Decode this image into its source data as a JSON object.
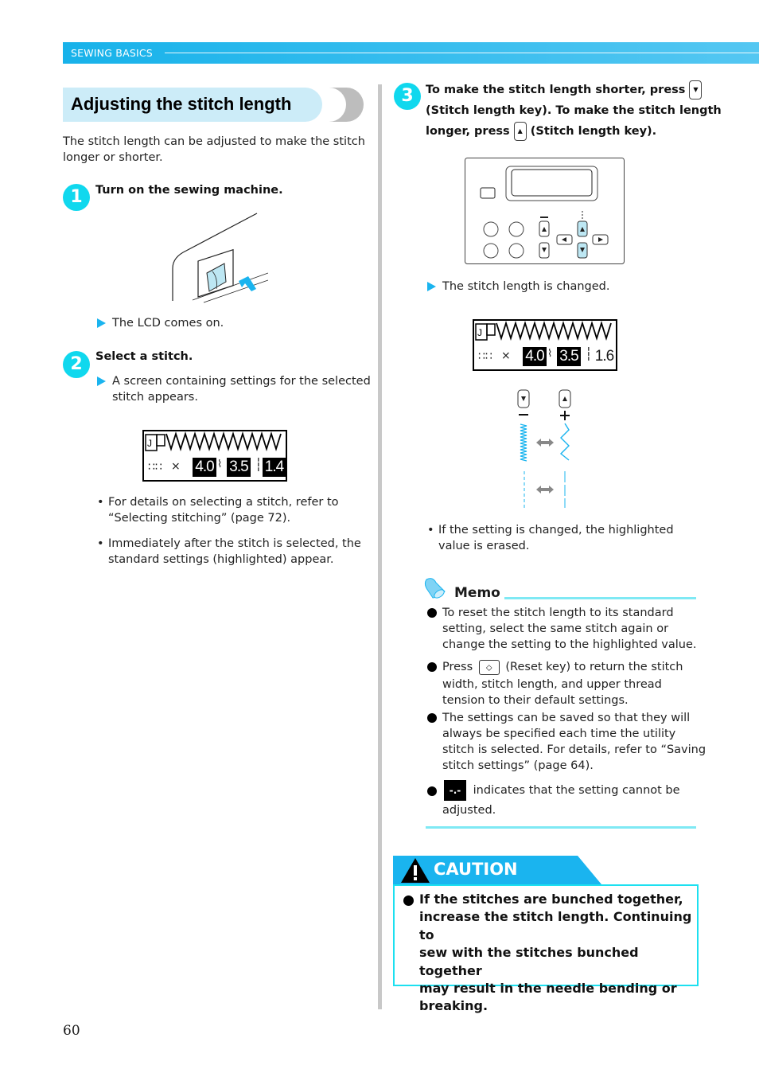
{
  "header": {
    "section": "SEWING BASICS",
    "color": "#17b2ea"
  },
  "title": "Adjusting the stitch length",
  "intro": [
    "The stitch length can be adjusted to make the stitch",
    "longer or shorter."
  ],
  "steps": [
    {
      "number": "1",
      "title": "Turn on the sewing machine.",
      "illustration": "power-switch",
      "result": "The LCD comes on."
    },
    {
      "number": "2",
      "title": "Select a stitch.",
      "result": [
        "A screen containing settings for the selected",
        "stitch appears."
      ],
      "lcd": {
        "width": "4.0",
        "length": "3.5",
        "tension": "1.4",
        "width_highlighted": true,
        "length_highlighted": true,
        "tension_highlighted": true
      },
      "notes": [
        [
          "For details on selecting a stitch, refer to",
          "“Selecting stitching” (page 72)."
        ],
        [
          "Immediately after the stitch is selected, the",
          "standard settings (highlighted) appear."
        ]
      ]
    },
    {
      "number": "3",
      "title_lines": [
        {
          "pre": "To make the stitch length shorter, press",
          "key": "down-arrow-key"
        },
        {
          "pre": "(Stitch length key). To make the stitch length"
        },
        {
          "pre": "longer, press",
          "key": "up-arrow-key",
          "post": "(Stitch length key)."
        }
      ],
      "result": "The stitch length is changed.",
      "lcd": {
        "width": "4.0",
        "length": "3.5",
        "tension": "1.6",
        "width_highlighted": true,
        "length_highlighted": true,
        "tension_highlighted": false
      },
      "diagram": {
        "minus": "−",
        "plus": "+"
      },
      "notes": [
        [
          "If the setting is changed, the highlighted",
          "value is erased."
        ]
      ]
    }
  ],
  "memo": {
    "title": "Memo",
    "items": [
      [
        "To reset the stitch length to its standard",
        "setting, select the same stitch again or",
        "change the setting to the highlighted value."
      ],
      {
        "pre": "Press",
        "key": "reset-key",
        "post": "(Reset key) to return the stitch",
        "rest": [
          "width, stitch length, and upper thread",
          "tension to their default settings."
        ]
      },
      [
        "The settings can be saved so that they will",
        "always be specified each time the utility",
        "stitch is selected. For details, refer to “Saving",
        "stitch settings” (page 64)."
      ],
      {
        "icon": "-.-",
        "post": "indicates that the setting cannot be",
        "rest": [
          "adjusted."
        ]
      }
    ]
  },
  "caution": {
    "title": "CAUTION",
    "lines": [
      "If the stitches are bunched together,",
      "increase the stitch length. Continuing to",
      "sew with the stitches bunched together",
      "may result in the needle bending or",
      "breaking."
    ]
  },
  "page_number": "60"
}
